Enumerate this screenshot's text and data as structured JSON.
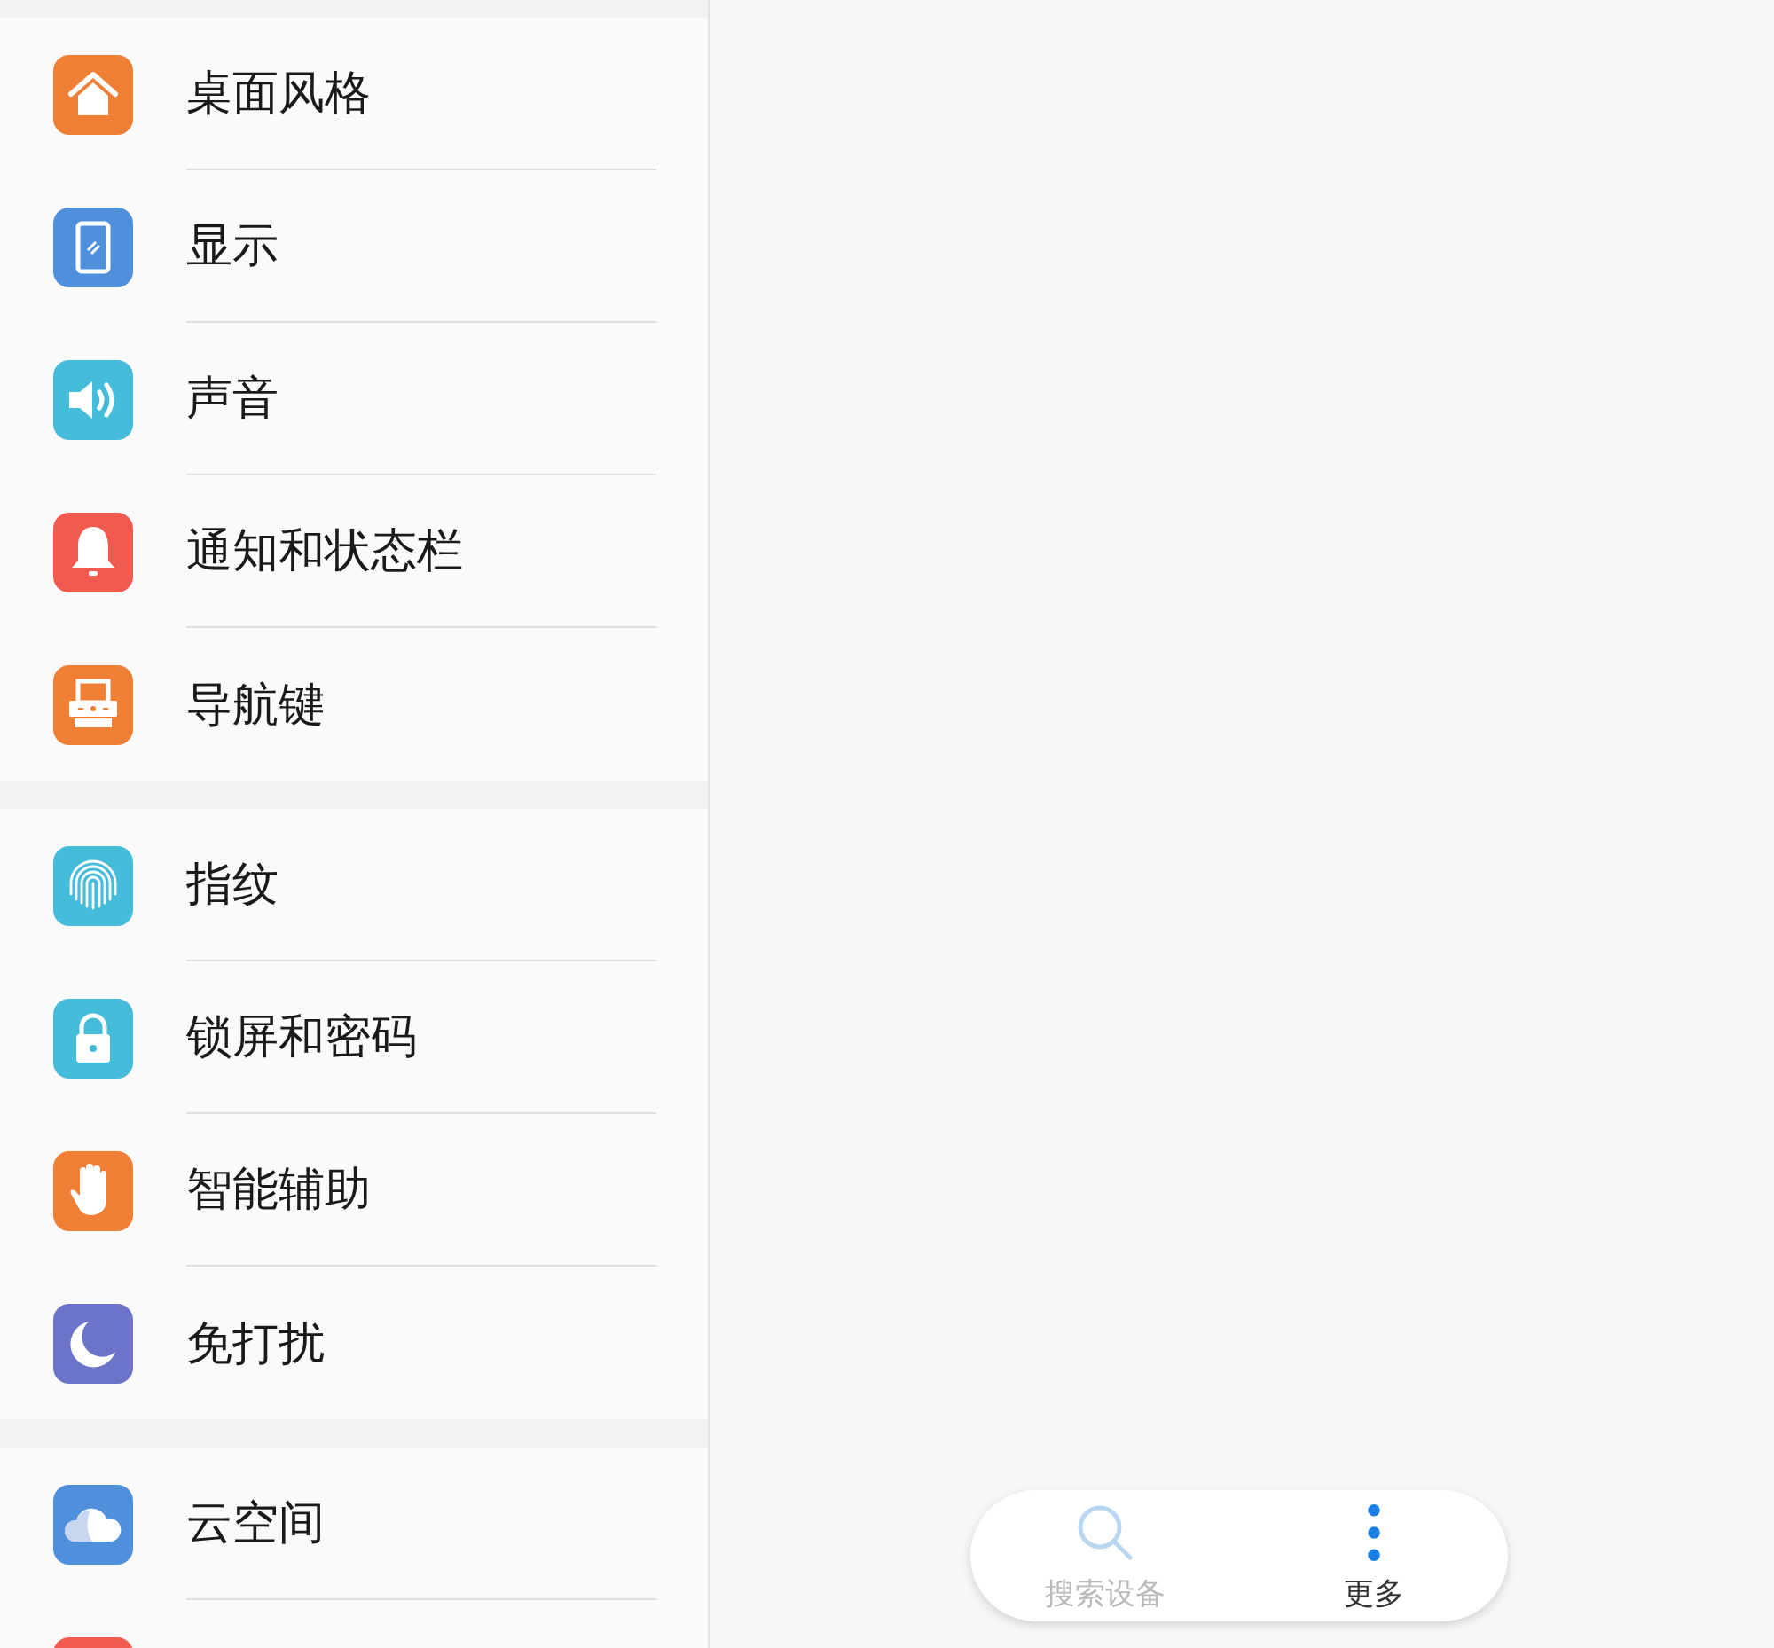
{
  "settings": [
    {
      "items": [
        {
          "label": "桌面风格",
          "kind": "home",
          "color": "#ef7f35"
        },
        {
          "label": "显示",
          "kind": "display",
          "color": "#4f8fdc"
        },
        {
          "label": "声音",
          "kind": "sound",
          "color": "#45bcd9"
        },
        {
          "label": "通知和状态栏",
          "kind": "bell",
          "color": "#f25a4f"
        },
        {
          "label": "导航键",
          "kind": "navkeys",
          "color": "#ef7f35"
        }
      ]
    },
    {
      "items": [
        {
          "label": "指纹",
          "kind": "fingerprint",
          "color": "#45bcd9"
        },
        {
          "label": "锁屏和密码",
          "kind": "lock",
          "color": "#45bcd9"
        },
        {
          "label": "智能辅助",
          "kind": "hand",
          "color": "#ef7f35"
        },
        {
          "label": "免打扰",
          "kind": "moon",
          "color": "#6b74c8"
        }
      ]
    },
    {
      "items": [
        {
          "label": "云空间",
          "kind": "cloud",
          "color": "#4f8fdc"
        },
        {
          "kind": "blank",
          "color": "#f25a4f"
        }
      ]
    }
  ],
  "actions": [
    {
      "label": "搜索设备",
      "kind": "search",
      "disabled": true
    },
    {
      "label": "更多",
      "kind": "more",
      "disabled": false
    }
  ]
}
